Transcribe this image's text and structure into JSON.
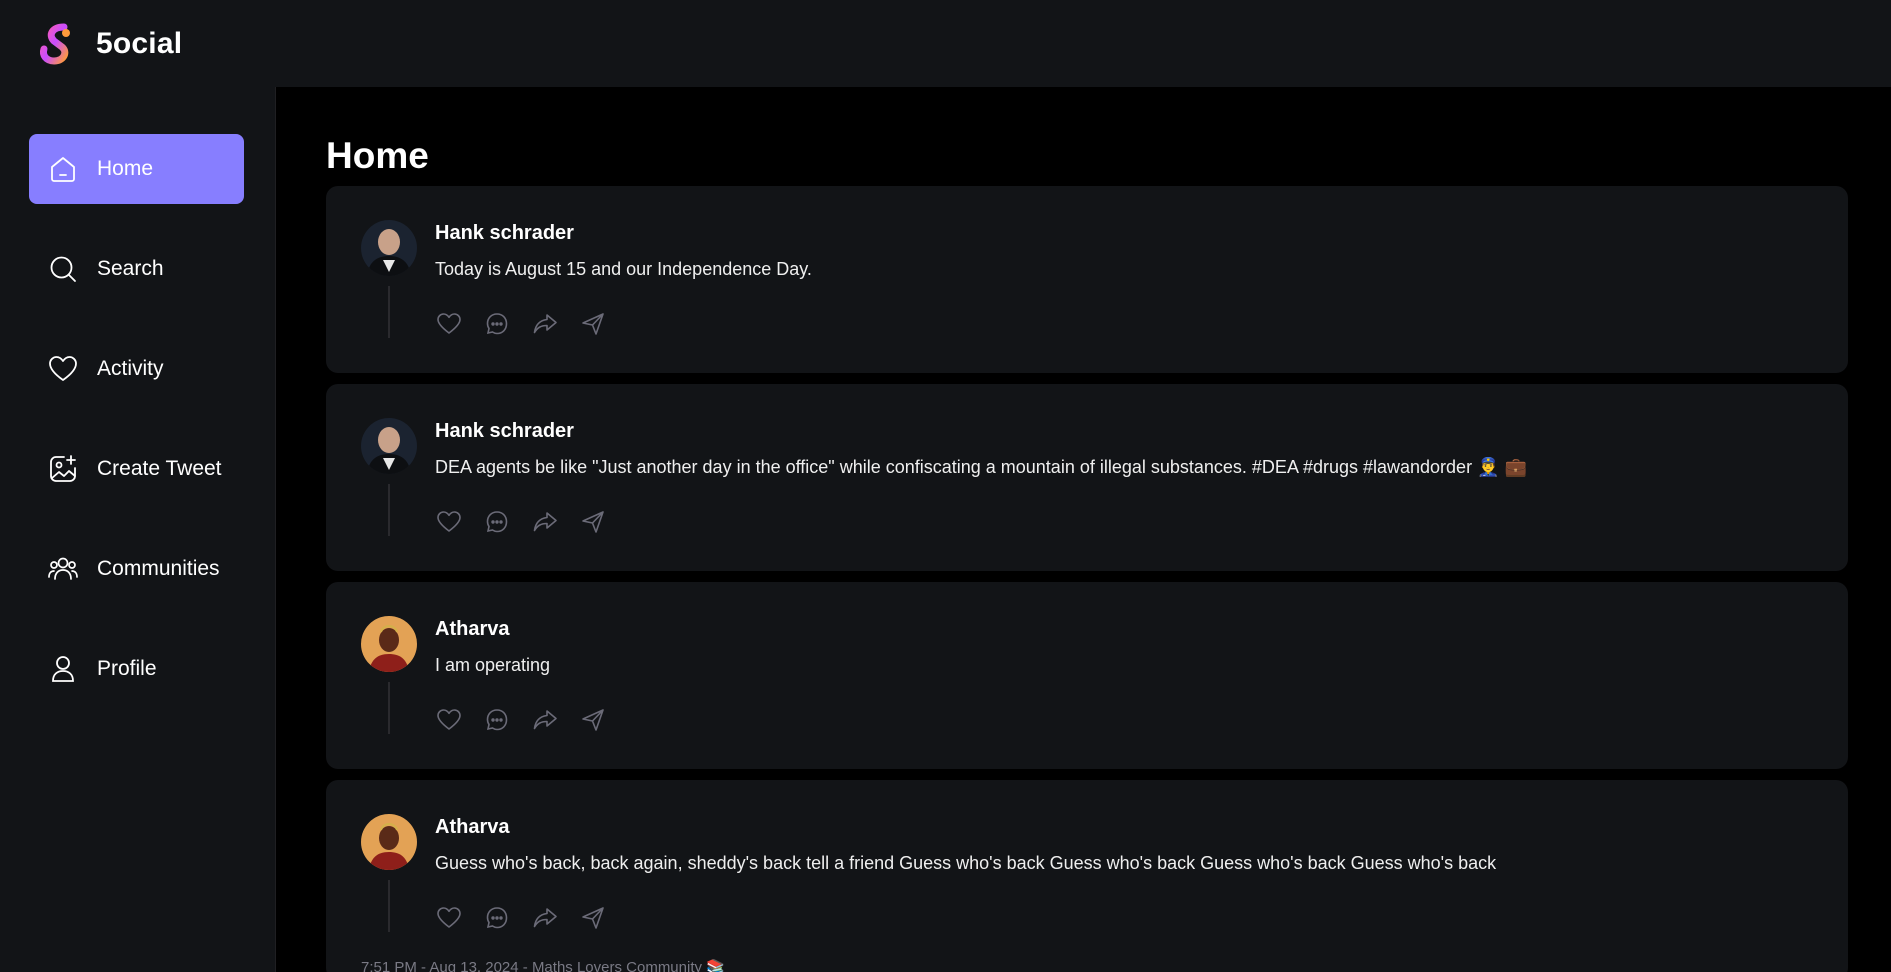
{
  "app": {
    "brand": "5ocial"
  },
  "sidebar": {
    "items": [
      {
        "label": "Home",
        "icon": "home-icon",
        "active": true
      },
      {
        "label": "Search",
        "icon": "search-icon",
        "active": false
      },
      {
        "label": "Activity",
        "icon": "heart-icon",
        "active": false
      },
      {
        "label": "Create Tweet",
        "icon": "gallery-add-icon",
        "active": false
      },
      {
        "label": "Communities",
        "icon": "people-icon",
        "active": false
      },
      {
        "label": "Profile",
        "icon": "user-icon",
        "active": false
      }
    ]
  },
  "main": {
    "title": "Home",
    "posts": [
      {
        "author": "Hank schrader",
        "content": "Today is August 15 and our Independence Day."
      },
      {
        "author": "Hank schrader",
        "content": "DEA agents be like \"Just another day in the office\" while confiscating a mountain of illegal substances. #DEA #drugs #lawandorder 👮‍♂️ 💼"
      },
      {
        "author": "Atharva",
        "content": "I am operating"
      },
      {
        "author": "Atharva",
        "content": "Guess who's back, back again, sheddy's back tell a friend Guess who's back Guess who's back Guess who's back Guess who's back",
        "meta": "7:51 PM - Aug 13, 2024 - Maths Lovers Community 📚"
      }
    ]
  },
  "colors": {
    "accent": "#877eff",
    "panel": "#121417",
    "background": "#000000"
  }
}
